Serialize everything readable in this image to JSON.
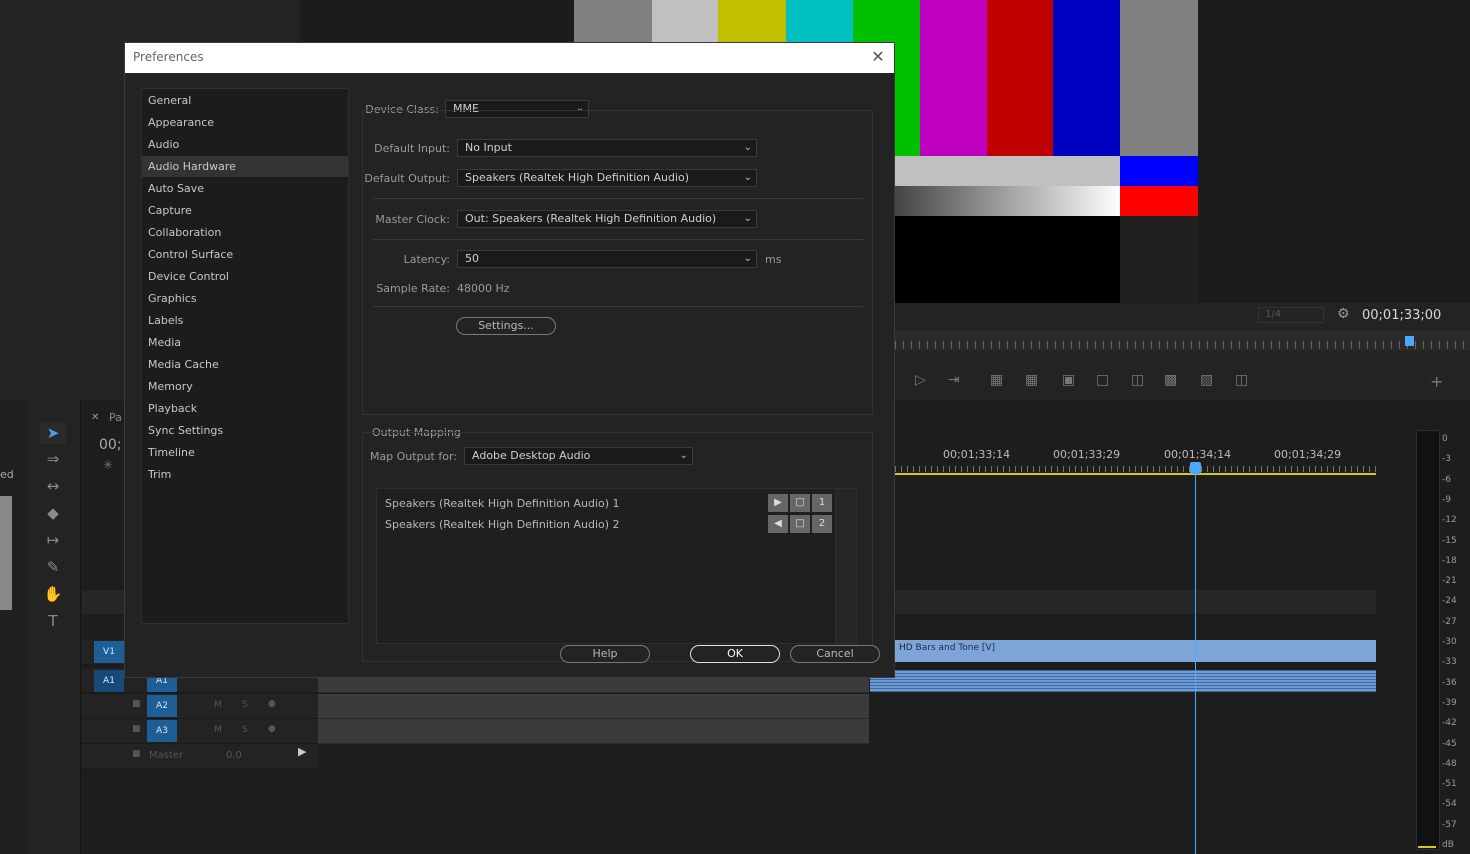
{
  "dialog": {
    "title": "Preferences",
    "sidebar": [
      "General",
      "Appearance",
      "Audio",
      "Audio Hardware",
      "Auto Save",
      "Capture",
      "Collaboration",
      "Control Surface",
      "Device Control",
      "Graphics",
      "Labels",
      "Media",
      "Media Cache",
      "Memory",
      "Playback",
      "Sync Settings",
      "Timeline",
      "Trim"
    ],
    "selected_index": 3,
    "device_class": {
      "label": "Device Class:",
      "value": "MME"
    },
    "default_input": {
      "label": "Default Input:",
      "value": "No Input"
    },
    "default_output": {
      "label": "Default Output:",
      "value": "Speakers (Realtek High Definition Audio)"
    },
    "master_clock": {
      "label": "Master Clock:",
      "value": "Out: Speakers (Realtek High Definition Audio)"
    },
    "latency": {
      "label": "Latency:",
      "value": "50",
      "unit": "ms"
    },
    "sample_rate": {
      "label": "Sample Rate:",
      "value": "48000 Hz"
    },
    "settings_button": "Settings...",
    "output_mapping": {
      "title": "Output Mapping",
      "label": "Map Output for:",
      "value": "Adobe Desktop Audio",
      "rows": [
        {
          "name": "Speakers (Realtek High Definition Audio) 1",
          "channel": "1"
        },
        {
          "name": "Speakers (Realtek High Definition Audio) 2",
          "channel": "2"
        }
      ]
    },
    "buttons": {
      "help": "Help",
      "ok": "OK",
      "cancel": "Cancel"
    }
  },
  "monitor": {
    "timecode": "00;01;33;00",
    "zoom": "1/4"
  },
  "timeline": {
    "timecodes": [
      "00;01;33;14",
      "00;01;33;29",
      "00;01;34;14",
      "00;01;34;29"
    ],
    "clip_video": "HD Bars and Tone [V]",
    "tracks": {
      "v1": "V1",
      "a1_src": "A1",
      "a1": "A1",
      "a2": "A2",
      "a3": "A3",
      "master": "Master",
      "master_val": "0.0",
      "m": "M",
      "s": "S"
    },
    "partial_tab": "Pa",
    "partial_tc": "00;",
    "partial_left": "ed"
  },
  "meter": {
    "scale": [
      "0",
      "-3",
      "-6",
      "-9",
      "-12",
      "-15",
      "-18",
      "-21",
      "-24",
      "-27",
      "-30",
      "-33",
      "-36",
      "-39",
      "-42",
      "-45",
      "-48",
      "-51",
      "-54",
      "-57",
      "dB"
    ]
  },
  "colors": {
    "accent": "#4aa8ff",
    "track_label": "#1e5e97",
    "clip_video": "#7ea5d8"
  }
}
